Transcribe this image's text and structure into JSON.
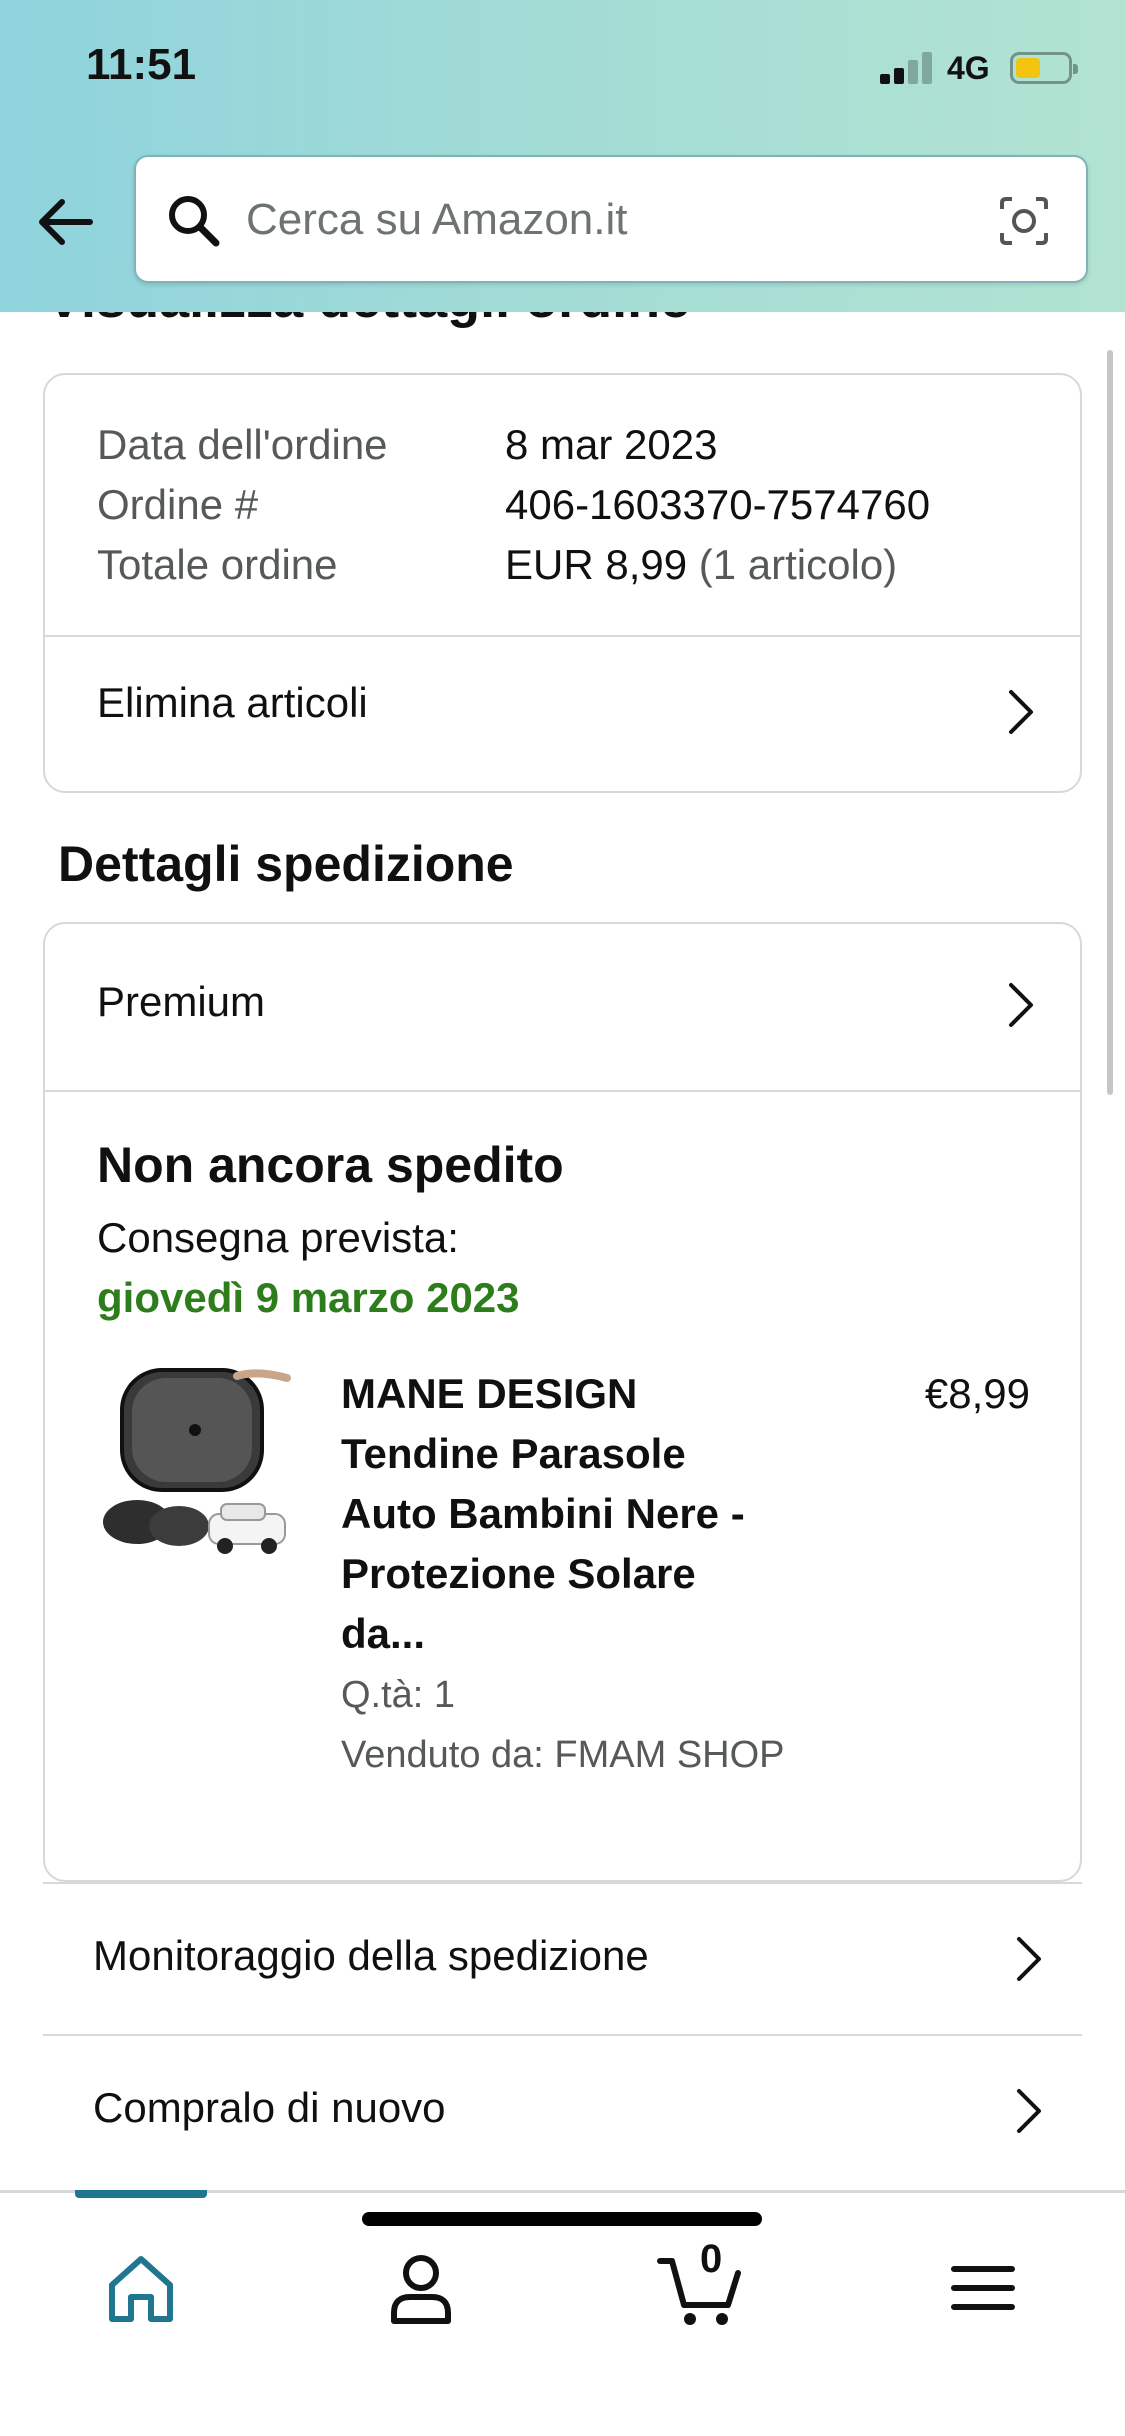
{
  "status_bar": {
    "time": "11:51",
    "network": "4G"
  },
  "search": {
    "placeholder": "Cerca su Amazon.it"
  },
  "page": {
    "title": "Visualizza dettagli ordine"
  },
  "order_summary": {
    "rows": [
      {
        "label": "Data dell'ordine",
        "value": "8 mar 2023"
      },
      {
        "label": "Ordine #",
        "value": "406-1603370-7574760"
      },
      {
        "label": "Totale ordine",
        "value": "EUR 8,99",
        "note": "(1 articolo)"
      }
    ],
    "delete_items": "Elimina articoli"
  },
  "shipping": {
    "section_title": "Dettagli spedizione",
    "method": "Premium",
    "status": "Non ancora spedito",
    "delivery_label": "Consegna prevista:",
    "delivery_date": "giovedì 9 marzo 2023",
    "product": {
      "title_lines": [
        "MANE DESIGN",
        "Tendine Parasole",
        "Auto Bambini Nere -",
        "Protezione Solare",
        "da..."
      ],
      "price": "€8,99",
      "quantity": "Q.tà: 1",
      "seller": "Venduto da: FMAM SHOP"
    }
  },
  "actions": {
    "track": "Monitoraggio della spedizione",
    "buy_again": "Compralo di nuovo"
  },
  "bottom_nav": {
    "cart_count": "0",
    "active": "home"
  },
  "colors": {
    "accent": "#21768f",
    "delivery_green": "#2e7d1d",
    "header_gradient_start": "#8fd3dd",
    "header_gradient_end": "#b2e3d2"
  }
}
